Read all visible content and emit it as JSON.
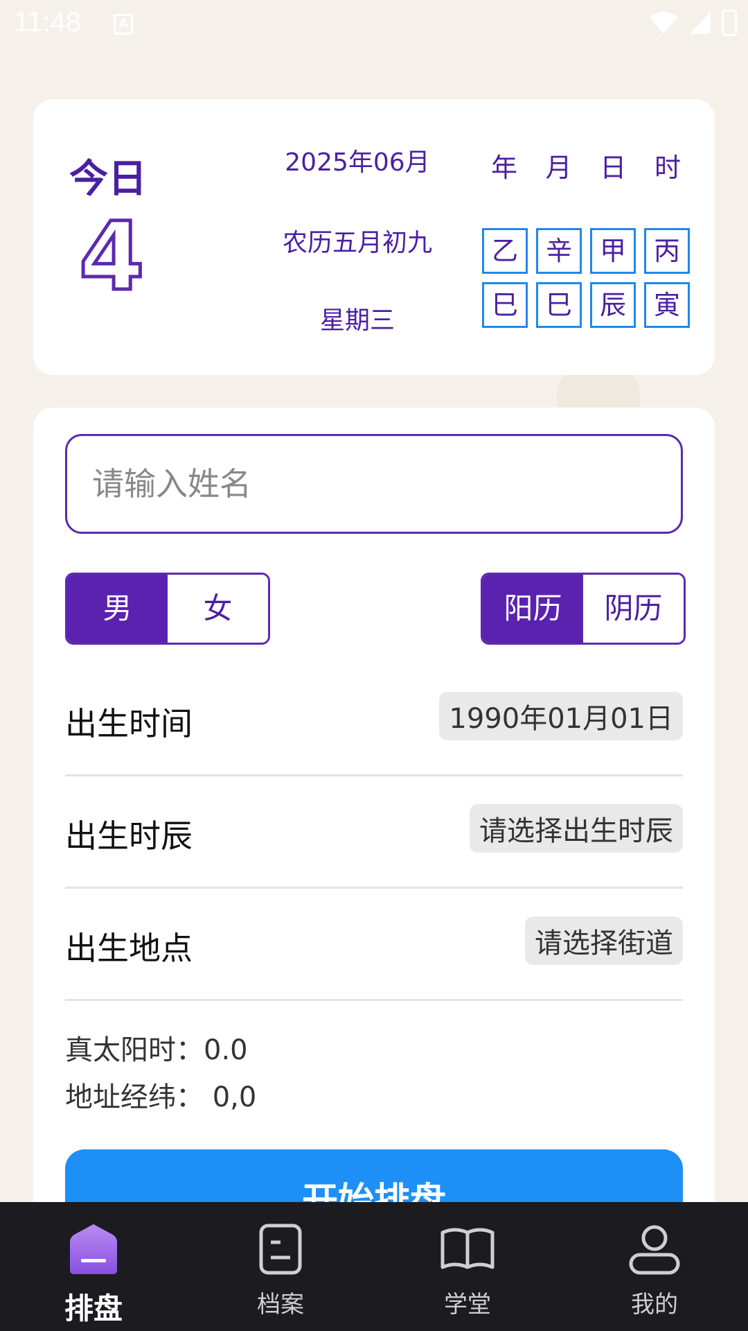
{
  "status_bar": {
    "time": "11:48",
    "a_icon": "A"
  },
  "today": {
    "label": "今日",
    "day": "4",
    "year_month": "2025年06月",
    "lunar": "农历五月初九",
    "weekday": "星期三",
    "ganzhi_heads": [
      "年",
      "月",
      "日",
      "时"
    ],
    "ganzhi_top": [
      "乙",
      "辛",
      "甲",
      "丙"
    ],
    "ganzhi_bottom": [
      "巳",
      "巳",
      "辰",
      "寅"
    ]
  },
  "form": {
    "name_placeholder": "请输入姓名",
    "gender": {
      "male": "男",
      "female": "女",
      "selected": "男"
    },
    "calendar": {
      "solar": "阳历",
      "lunar": "阴历",
      "selected": "阳历"
    },
    "birth_time": {
      "label": "出生时间",
      "value": "1990年01月01日"
    },
    "birth_hour": {
      "label": "出生时辰",
      "value": "请选择出生时辰"
    },
    "birth_place": {
      "label": "出生地点",
      "value": "请选择街道"
    },
    "true_solar_time": "真太阳时：0.0",
    "coordinates": "地址经纬： 0,0",
    "start_button": "开始排盘"
  },
  "bottom_nav": [
    {
      "label": "排盘",
      "icon": "home-icon",
      "active": true
    },
    {
      "label": "档案",
      "icon": "document-icon",
      "active": false
    },
    {
      "label": "学堂",
      "icon": "book-icon",
      "active": false
    },
    {
      "label": "我的",
      "icon": "user-icon",
      "active": false
    }
  ],
  "colors": {
    "accent": "#5b22b0",
    "button_blue": "#1e8ff7",
    "ganzhi_border": "#1e88f0",
    "nav_bg": "#1b1b20"
  }
}
